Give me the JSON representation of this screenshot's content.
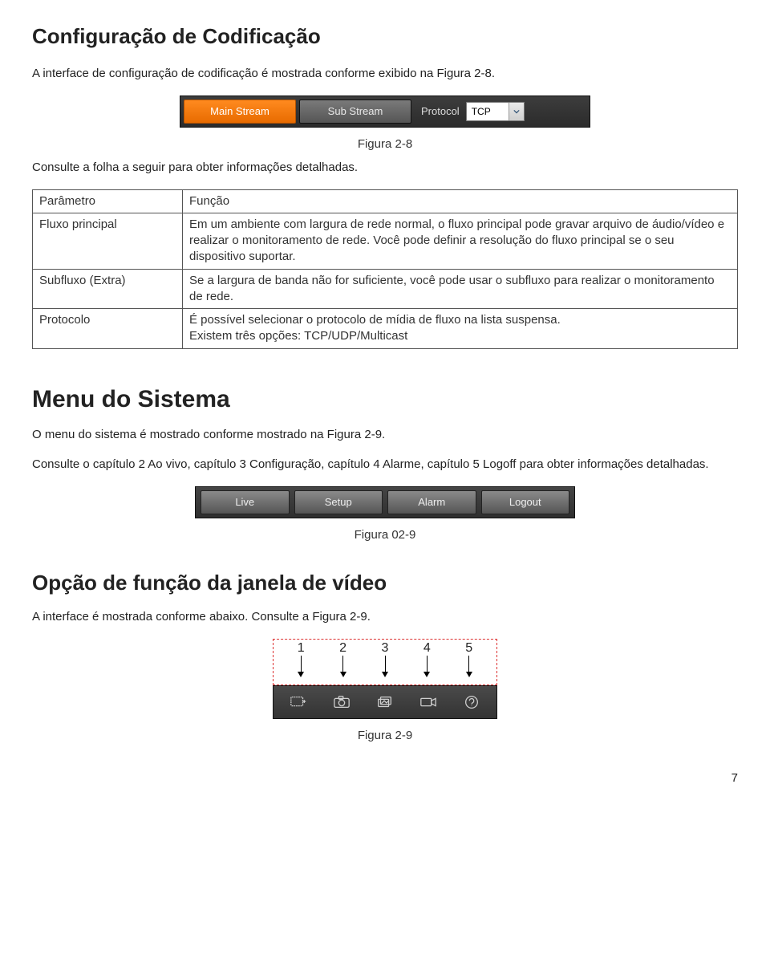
{
  "page_number": "7",
  "section1": {
    "title": "Configuração de Codificação",
    "intro": "A interface de configuração de codificação é mostrada conforme exibido na Figura 2-8.",
    "fig_caption": "Figura 2-8",
    "after_fig": "Consulte a folha a seguir para obter informações detalhadas.",
    "toolbar": {
      "main_stream": "Main Stream",
      "sub_stream": "Sub Stream",
      "protocol_label": "Protocol",
      "protocol_value": "TCP"
    },
    "table": {
      "h_param": "Parâmetro",
      "h_func": "Função",
      "rows": [
        {
          "param": "Fluxo principal",
          "func": "Em um ambiente com largura de rede normal, o fluxo principal pode gravar arquivo de áudio/vídeo e realizar o monitoramento de rede. Você pode definir a resolução do fluxo principal se o seu dispositivo suportar."
        },
        {
          "param": "Subfluxo (Extra)",
          "func": "Se a largura de banda não for suficiente, você pode usar o subfluxo para realizar o monitoramento de rede."
        },
        {
          "param": "Protocolo",
          "func": "É possível selecionar o protocolo de mídia de fluxo na lista suspensa.\nExistem três opções: TCP/UDP/Multicast"
        }
      ]
    }
  },
  "section2": {
    "title": "Menu do Sistema",
    "p1": "O menu do sistema é mostrado conforme mostrado na Figura 2-9.",
    "p2": "Consulte o capítulo 2 Ao vivo, capítulo 3 Configuração, capítulo 4 Alarme, capítulo 5 Logoff para obter informações detalhadas.",
    "fig_caption": "Figura 02-9",
    "menu": [
      "Live",
      "Setup",
      "Alarm",
      "Logout"
    ]
  },
  "section3": {
    "title": "Opção de função da janela de vídeo",
    "p1": "A interface é mostrada conforme abaixo. Consulte a Figura 2-9.",
    "numbers": [
      "1",
      "2",
      "3",
      "4",
      "5"
    ],
    "fig_caption": "Figura 2-9"
  }
}
